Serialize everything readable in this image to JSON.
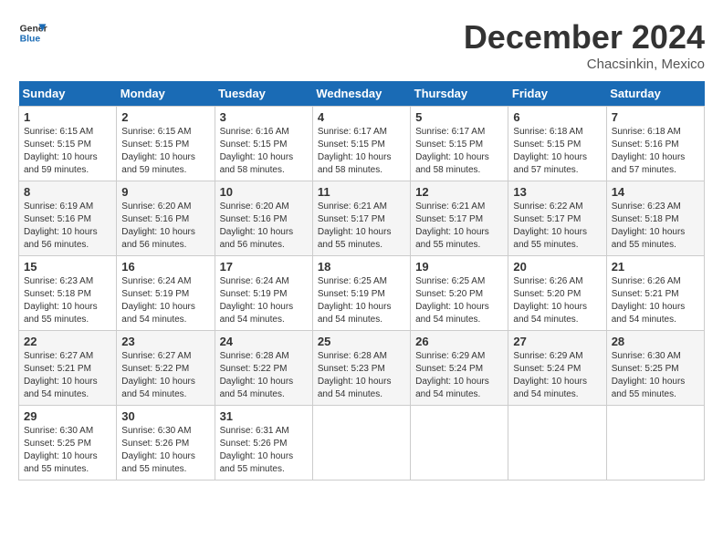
{
  "logo": {
    "line1": "General",
    "line2": "Blue"
  },
  "header": {
    "month": "December 2024",
    "location": "Chacsinkin, Mexico"
  },
  "weekdays": [
    "Sunday",
    "Monday",
    "Tuesday",
    "Wednesday",
    "Thursday",
    "Friday",
    "Saturday"
  ],
  "weeks": [
    [
      {
        "day": "1",
        "sunrise": "6:15 AM",
        "sunset": "5:15 PM",
        "daylight": "10 hours and 59 minutes."
      },
      {
        "day": "2",
        "sunrise": "6:15 AM",
        "sunset": "5:15 PM",
        "daylight": "10 hours and 59 minutes."
      },
      {
        "day": "3",
        "sunrise": "6:16 AM",
        "sunset": "5:15 PM",
        "daylight": "10 hours and 58 minutes."
      },
      {
        "day": "4",
        "sunrise": "6:17 AM",
        "sunset": "5:15 PM",
        "daylight": "10 hours and 58 minutes."
      },
      {
        "day": "5",
        "sunrise": "6:17 AM",
        "sunset": "5:15 PM",
        "daylight": "10 hours and 58 minutes."
      },
      {
        "day": "6",
        "sunrise": "6:18 AM",
        "sunset": "5:15 PM",
        "daylight": "10 hours and 57 minutes."
      },
      {
        "day": "7",
        "sunrise": "6:18 AM",
        "sunset": "5:16 PM",
        "daylight": "10 hours and 57 minutes."
      }
    ],
    [
      {
        "day": "8",
        "sunrise": "6:19 AM",
        "sunset": "5:16 PM",
        "daylight": "10 hours and 56 minutes."
      },
      {
        "day": "9",
        "sunrise": "6:20 AM",
        "sunset": "5:16 PM",
        "daylight": "10 hours and 56 minutes."
      },
      {
        "day": "10",
        "sunrise": "6:20 AM",
        "sunset": "5:16 PM",
        "daylight": "10 hours and 56 minutes."
      },
      {
        "day": "11",
        "sunrise": "6:21 AM",
        "sunset": "5:17 PM",
        "daylight": "10 hours and 55 minutes."
      },
      {
        "day": "12",
        "sunrise": "6:21 AM",
        "sunset": "5:17 PM",
        "daylight": "10 hours and 55 minutes."
      },
      {
        "day": "13",
        "sunrise": "6:22 AM",
        "sunset": "5:17 PM",
        "daylight": "10 hours and 55 minutes."
      },
      {
        "day": "14",
        "sunrise": "6:23 AM",
        "sunset": "5:18 PM",
        "daylight": "10 hours and 55 minutes."
      }
    ],
    [
      {
        "day": "15",
        "sunrise": "6:23 AM",
        "sunset": "5:18 PM",
        "daylight": "10 hours and 55 minutes."
      },
      {
        "day": "16",
        "sunrise": "6:24 AM",
        "sunset": "5:19 PM",
        "daylight": "10 hours and 54 minutes."
      },
      {
        "day": "17",
        "sunrise": "6:24 AM",
        "sunset": "5:19 PM",
        "daylight": "10 hours and 54 minutes."
      },
      {
        "day": "18",
        "sunrise": "6:25 AM",
        "sunset": "5:19 PM",
        "daylight": "10 hours and 54 minutes."
      },
      {
        "day": "19",
        "sunrise": "6:25 AM",
        "sunset": "5:20 PM",
        "daylight": "10 hours and 54 minutes."
      },
      {
        "day": "20",
        "sunrise": "6:26 AM",
        "sunset": "5:20 PM",
        "daylight": "10 hours and 54 minutes."
      },
      {
        "day": "21",
        "sunrise": "6:26 AM",
        "sunset": "5:21 PM",
        "daylight": "10 hours and 54 minutes."
      }
    ],
    [
      {
        "day": "22",
        "sunrise": "6:27 AM",
        "sunset": "5:21 PM",
        "daylight": "10 hours and 54 minutes."
      },
      {
        "day": "23",
        "sunrise": "6:27 AM",
        "sunset": "5:22 PM",
        "daylight": "10 hours and 54 minutes."
      },
      {
        "day": "24",
        "sunrise": "6:28 AM",
        "sunset": "5:22 PM",
        "daylight": "10 hours and 54 minutes."
      },
      {
        "day": "25",
        "sunrise": "6:28 AM",
        "sunset": "5:23 PM",
        "daylight": "10 hours and 54 minutes."
      },
      {
        "day": "26",
        "sunrise": "6:29 AM",
        "sunset": "5:24 PM",
        "daylight": "10 hours and 54 minutes."
      },
      {
        "day": "27",
        "sunrise": "6:29 AM",
        "sunset": "5:24 PM",
        "daylight": "10 hours and 54 minutes."
      },
      {
        "day": "28",
        "sunrise": "6:30 AM",
        "sunset": "5:25 PM",
        "daylight": "10 hours and 55 minutes."
      }
    ],
    [
      {
        "day": "29",
        "sunrise": "6:30 AM",
        "sunset": "5:25 PM",
        "daylight": "10 hours and 55 minutes."
      },
      {
        "day": "30",
        "sunrise": "6:30 AM",
        "sunset": "5:26 PM",
        "daylight": "10 hours and 55 minutes."
      },
      {
        "day": "31",
        "sunrise": "6:31 AM",
        "sunset": "5:26 PM",
        "daylight": "10 hours and 55 minutes."
      },
      null,
      null,
      null,
      null
    ]
  ],
  "labels": {
    "sunrise": "Sunrise: ",
    "sunset": "Sunset: ",
    "daylight": "Daylight: "
  }
}
